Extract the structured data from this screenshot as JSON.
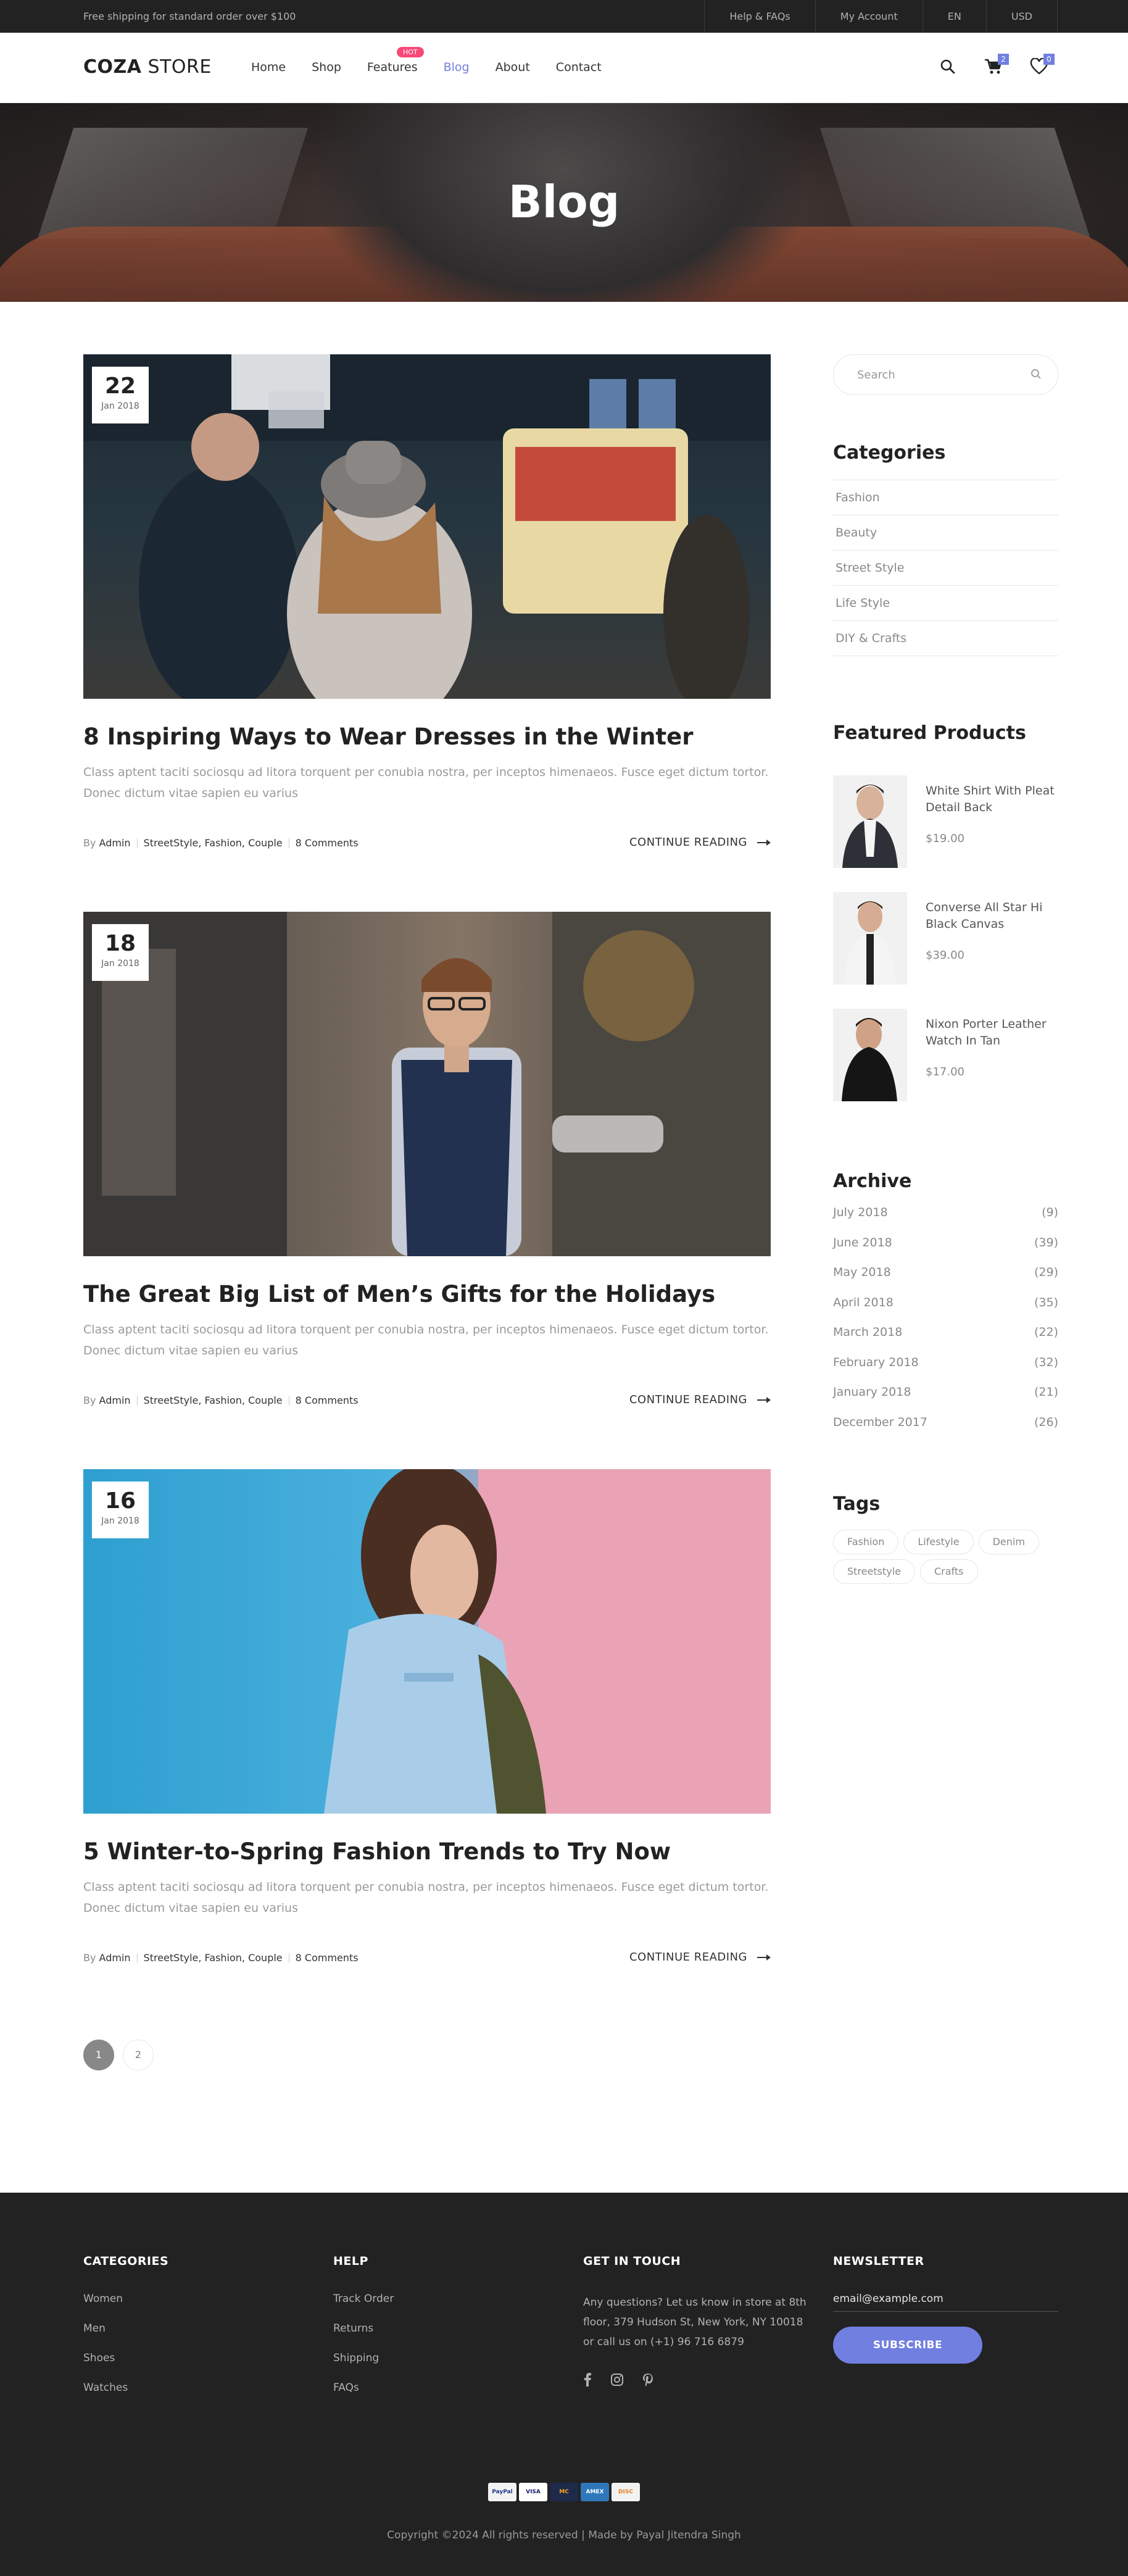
{
  "topbar": {
    "shipping_text": "Free shipping for standard order over $100",
    "links": [
      "Help & FAQs",
      "My Account",
      "EN",
      "USD"
    ]
  },
  "header": {
    "logo_bold": "COZA",
    "logo_light": " STORE",
    "nav": [
      {
        "label": "Home",
        "active": false
      },
      {
        "label": "Shop",
        "active": false
      },
      {
        "label": "Features",
        "active": false,
        "badge": "HOT"
      },
      {
        "label": "Blog",
        "active": true
      },
      {
        "label": "About",
        "active": false
      },
      {
        "label": "Contact",
        "active": false
      }
    ],
    "cart_count": "2",
    "wishlist_count": "0",
    "accent_color": "#717fe0"
  },
  "hero": {
    "title": "Blog"
  },
  "posts": [
    {
      "day": "22",
      "month": "Jan 2018",
      "title": "8 Inspiring Ways to Wear Dresses in the Winter",
      "excerpt": "Class aptent taciti sociosqu ad litora torquent per conubia nostra, per inceptos himenaeos. Fusce eget dictum tortor. Donec dictum vitae sapien eu varius",
      "by": "By",
      "author": "Admin",
      "tags": "StreetStyle, Fashion, Couple",
      "comments": "8 Comments",
      "read_more": "CONTINUE READING"
    },
    {
      "day": "18",
      "month": "Jan 2018",
      "title": "The Great Big List of Men’s Gifts for the Holidays",
      "excerpt": "Class aptent taciti sociosqu ad litora torquent per conubia nostra, per inceptos himenaeos. Fusce eget dictum tortor. Donec dictum vitae sapien eu varius",
      "by": "By",
      "author": "Admin",
      "tags": "StreetStyle, Fashion, Couple",
      "comments": "8 Comments",
      "read_more": "CONTINUE READING"
    },
    {
      "day": "16",
      "month": "Jan 2018",
      "title": "5 Winter-to-Spring Fashion Trends to Try Now",
      "excerpt": "Class aptent taciti sociosqu ad litora torquent per conubia nostra, per inceptos himenaeos. Fusce eget dictum tortor. Donec dictum vitae sapien eu varius",
      "by": "By",
      "author": "Admin",
      "tags": "StreetStyle, Fashion, Couple",
      "comments": "8 Comments",
      "read_more": "CONTINUE READING"
    }
  ],
  "pagination": {
    "pages": [
      "1",
      "2"
    ],
    "current": "1"
  },
  "sidebar": {
    "search_placeholder": "Search",
    "categories_title": "Categories",
    "categories": [
      "Fashion",
      "Beauty",
      "Street Style",
      "Life Style",
      "DIY & Crafts"
    ],
    "featured_title": "Featured Products",
    "featured": [
      {
        "name": "White Shirt With Pleat Detail Back",
        "price": "$19.00"
      },
      {
        "name": "Converse All Star Hi Black Canvas",
        "price": "$39.00"
      },
      {
        "name": "Nixon Porter Leather Watch In Tan",
        "price": "$17.00"
      }
    ],
    "archive_title": "Archive",
    "archive": [
      {
        "month": "July 2018",
        "count": "(9)"
      },
      {
        "month": "June 2018",
        "count": "(39)"
      },
      {
        "month": "May 2018",
        "count": "(29)"
      },
      {
        "month": "April 2018",
        "count": "(35)"
      },
      {
        "month": "March 2018",
        "count": "(22)"
      },
      {
        "month": "February 2018",
        "count": "(32)"
      },
      {
        "month": "January 2018",
        "count": "(21)"
      },
      {
        "month": "December 2017",
        "count": "(26)"
      }
    ],
    "tags_title": "Tags",
    "tags": [
      "Fashion",
      "Lifestyle",
      "Denim",
      "Streetstyle",
      "Crafts"
    ]
  },
  "footer": {
    "categories_title": "CATEGORIES",
    "categories": [
      "Women",
      "Men",
      "Shoes",
      "Watches"
    ],
    "help_title": "HELP",
    "help": [
      "Track Order",
      "Returns",
      "Shipping",
      "FAQs"
    ],
    "contact_title": "GET IN TOUCH",
    "contact_text": "Any questions? Let us know in store at 8th floor, 379 Hudson St, New York, NY 10018 or call us on (+1) 96 716 6879",
    "newsletter_title": "NEWSLETTER",
    "email_placeholder": "email@example.com",
    "subscribe_label": "SUBSCRIBE",
    "payment_icons": [
      "paypal-icon",
      "visa-icon",
      "mastercard-icon",
      "amex-icon",
      "discover-icon"
    ],
    "payment_labels": [
      "PayPal",
      "VISA",
      "MC",
      "AMEX",
      "DISC"
    ],
    "copyright": "Copyright ©2024 All rights reserved | Made by Payal Jitendra Singh"
  }
}
